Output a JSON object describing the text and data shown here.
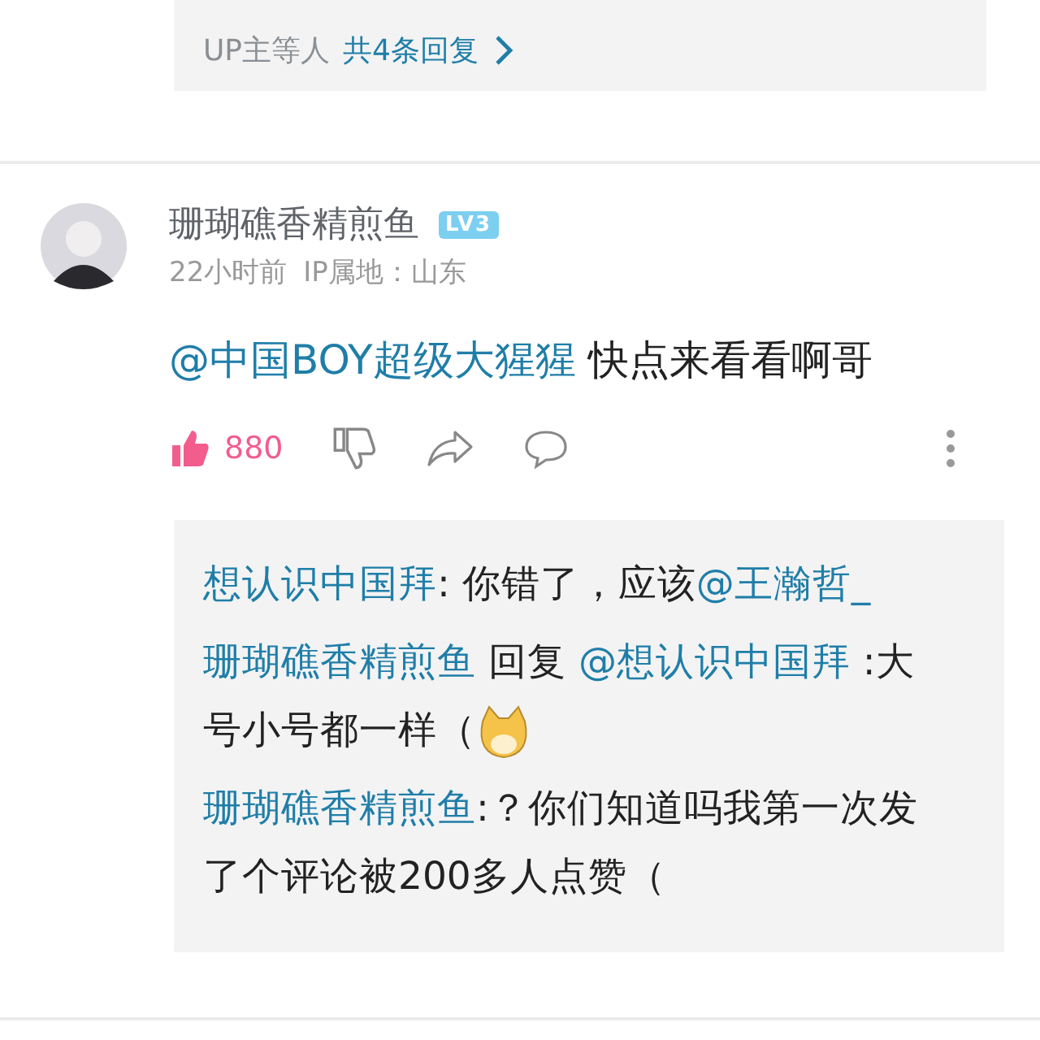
{
  "top_replies": {
    "prefix": "UP主等人",
    "link": "共4条回复"
  },
  "comment": {
    "author": "珊瑚礁香精煎鱼",
    "level": "LV3",
    "time": "22小时前",
    "ip": "IP属地：山东",
    "body": [
      {
        "kind": "mention",
        "text": "@中国BOY超级大猩猩"
      },
      {
        "kind": "text",
        "text": " 快点来看看啊哥"
      }
    ],
    "likes": "880",
    "liked": true,
    "replies": [
      {
        "segments": [
          {
            "kind": "name",
            "text": "想认识中国拜"
          },
          {
            "kind": "text",
            "text": ": 你错了，应该"
          },
          {
            "kind": "mention",
            "text": "@王瀚哲_"
          }
        ]
      },
      {
        "segments": [
          {
            "kind": "name",
            "text": "珊瑚礁香精煎鱼"
          },
          {
            "kind": "text",
            "text": " 回复 "
          },
          {
            "kind": "mention",
            "text": "@想认识中国拜"
          },
          {
            "kind": "text",
            "text": " :大号小号都一样（"
          },
          {
            "kind": "emoji"
          }
        ]
      },
      {
        "segments": [
          {
            "kind": "name",
            "text": "珊瑚礁香精煎鱼"
          },
          {
            "kind": "text",
            "text": ":？你们知道吗我第一次发了个评论被200多人点赞（"
          }
        ]
      }
    ]
  }
}
